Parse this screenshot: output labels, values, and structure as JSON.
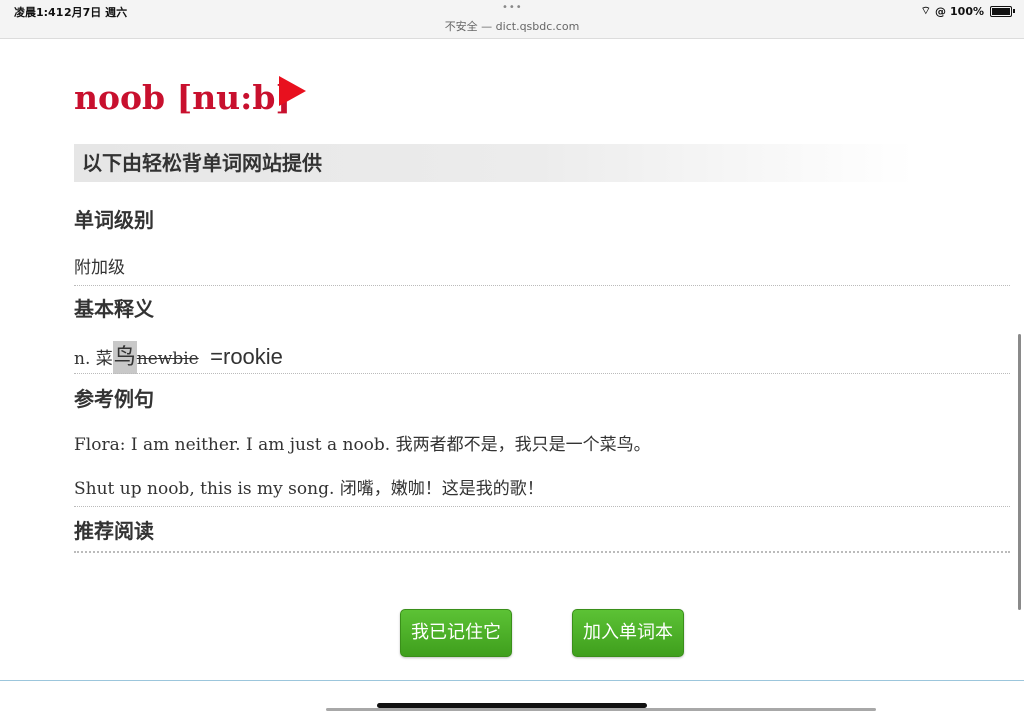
{
  "status": {
    "time": "凌晨1:41",
    "date": "2月7日 週六",
    "url": "不安全 — dict.qsbdc.com",
    "battery": "100%"
  },
  "word": {
    "title": "noob [nu:b]"
  },
  "provider": "以下由轻松背单词网站提供",
  "sections": {
    "level_heading": "单词级别",
    "level_value": "附加级",
    "meaning_heading": "基本释义",
    "meaning_pos": "n.",
    "meaning_cn_1": "菜",
    "meaning_cn_2": "鸟",
    "meaning_en": "newbie",
    "meaning_syn": "=rookie",
    "examples_heading": "参考例句",
    "example_1_en": "Flora: I am neither. I am just a noob.",
    "example_1_cn": "我两者都不是，我只是一个菜鸟。",
    "example_2_en": "Shut up noob, this is my song.",
    "example_2_cn": "闭嘴，嫩咖！这是我的歌！",
    "reading_heading": "推荐阅读"
  },
  "buttons": {
    "remember": "我已记住它",
    "add": "加入单词本"
  }
}
